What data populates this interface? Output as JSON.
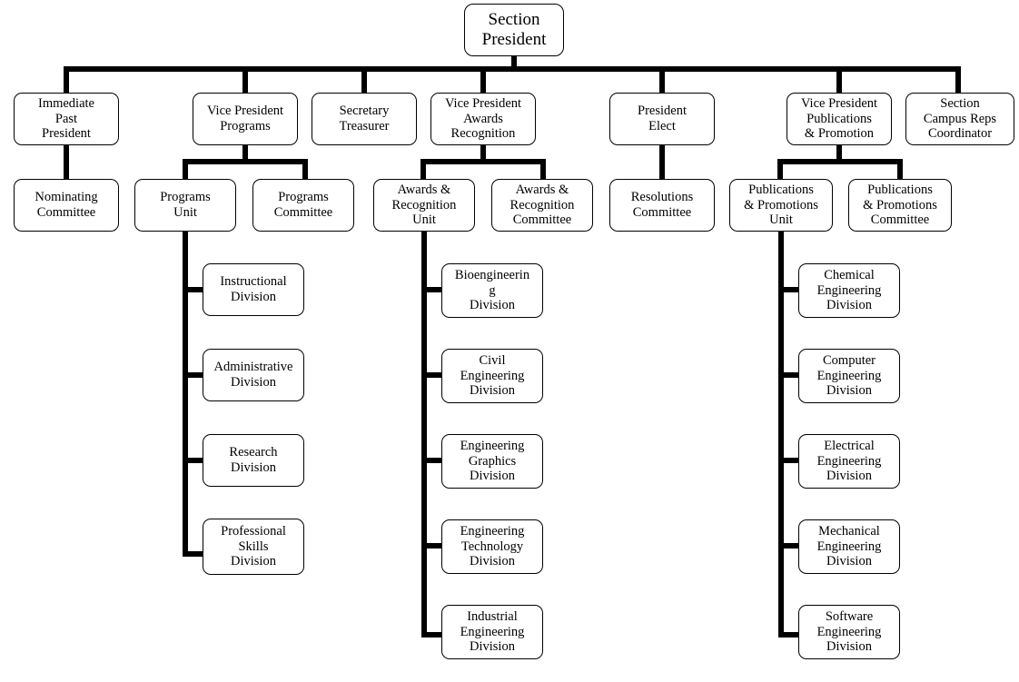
{
  "chart_data": {
    "type": "diagram",
    "title": "Section Organizational Chart",
    "orientation": "top-down tree with vertical spines for division lists",
    "levels": 4
  },
  "root": {
    "label": "Section\nPresident"
  },
  "officers": [
    {
      "label": "Immediate\nPast\nPresident"
    },
    {
      "label": "Vice President\nPrograms"
    },
    {
      "label": "Secretary\nTreasurer"
    },
    {
      "label": "Vice President\nAwards\nRecognition"
    },
    {
      "label": "President\nElect"
    },
    {
      "label": "Vice President\nPublications\n& Promotion"
    },
    {
      "label": "Section\nCampus  Reps\nCoordinator"
    }
  ],
  "groups": [
    {
      "label": "Nominating\nCommittee"
    },
    {
      "label": "Programs\nUnit"
    },
    {
      "label": "Programs\nCommittee"
    },
    {
      "label": "Awards &\nRecognition\nUnit"
    },
    {
      "label": "Awards &\nRecognition\nCommittee"
    },
    {
      "label": "Resolutions\nCommittee"
    },
    {
      "label": "Publications\n& Promotions\nUnit"
    },
    {
      "label": "Publications\n& Promotions\nCommittee"
    }
  ],
  "programs_divisions": [
    {
      "label": "Instructional\nDivision"
    },
    {
      "label": "Administrative\nDivision"
    },
    {
      "label": "Research\nDivision"
    },
    {
      "label": "Professional\nSkills\nDivision"
    }
  ],
  "awards_divisions": [
    {
      "label": "Bioengineerin\ng\nDivision"
    },
    {
      "label": "Civil\nEngineering\nDivision"
    },
    {
      "label": "Engineering\nGraphics\nDivision"
    },
    {
      "label": "Engineering\nTechnology\nDivision"
    },
    {
      "label": "Industrial\nEngineering\nDivision"
    }
  ],
  "publications_divisions": [
    {
      "label": "Chemical\nEngineering\nDivision"
    },
    {
      "label": "Computer\nEngineering\nDivision"
    },
    {
      "label": "Electrical\nEngineering\nDivision"
    },
    {
      "label": "Mechanical\nEngineering\nDivision"
    },
    {
      "label": "Software\nEngineering\nDivision"
    }
  ],
  "colors": {
    "line": "#000000",
    "box_fill": "#ffffff",
    "box_border": "#000000",
    "text": "#000000"
  }
}
